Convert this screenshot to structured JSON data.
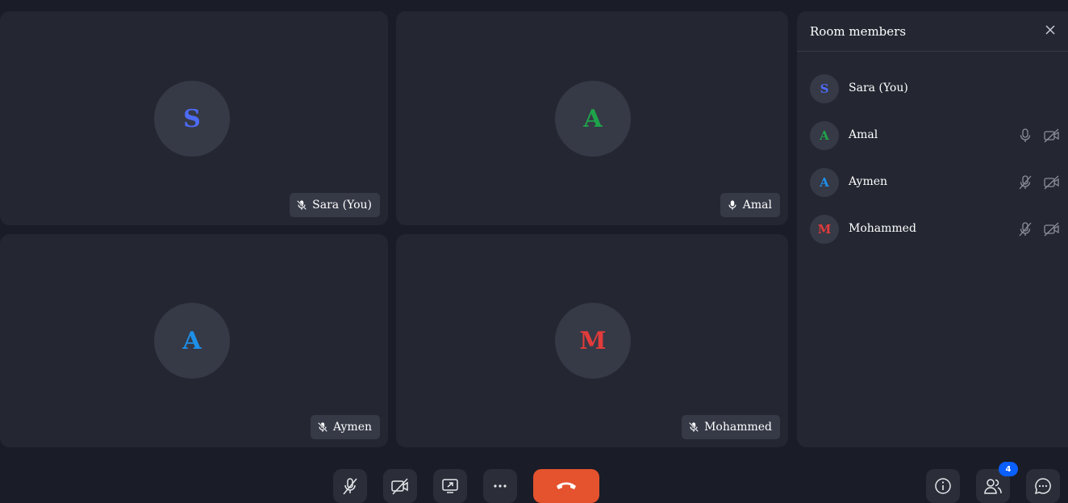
{
  "tiles": [
    {
      "initial": "S",
      "name": "Sara (You)",
      "color": "#4d6bf5"
    },
    {
      "initial": "A",
      "name": "Amal",
      "color": "#1fa34a"
    },
    {
      "initial": "A",
      "name": "Aymen",
      "color": "#1e90e8"
    },
    {
      "initial": "M",
      "name": "Mohammed",
      "color": "#e23b3b"
    }
  ],
  "panel": {
    "title": "Room members",
    "members": [
      {
        "initial": "S",
        "name": "Sara (You)",
        "color": "#4d6bf5",
        "mic_icon": "",
        "cam_icon": ""
      },
      {
        "initial": "A",
        "name": "Amal",
        "color": "#1fa34a",
        "mic_icon": "mic-icon",
        "cam_icon": "camera-off-icon"
      },
      {
        "initial": "A",
        "name": "Aymen",
        "color": "#1e90e8",
        "mic_icon": "mic-off-icon",
        "cam_icon": "camera-off-icon"
      },
      {
        "initial": "M",
        "name": "Mohammed",
        "color": "#e23b3b",
        "mic_icon": "mic-off-icon",
        "cam_icon": "camera-off-icon"
      }
    ]
  },
  "toolbar": {
    "participants_count": "4",
    "leave_color": "#e4532e",
    "badge_color": "#0a5fff"
  }
}
